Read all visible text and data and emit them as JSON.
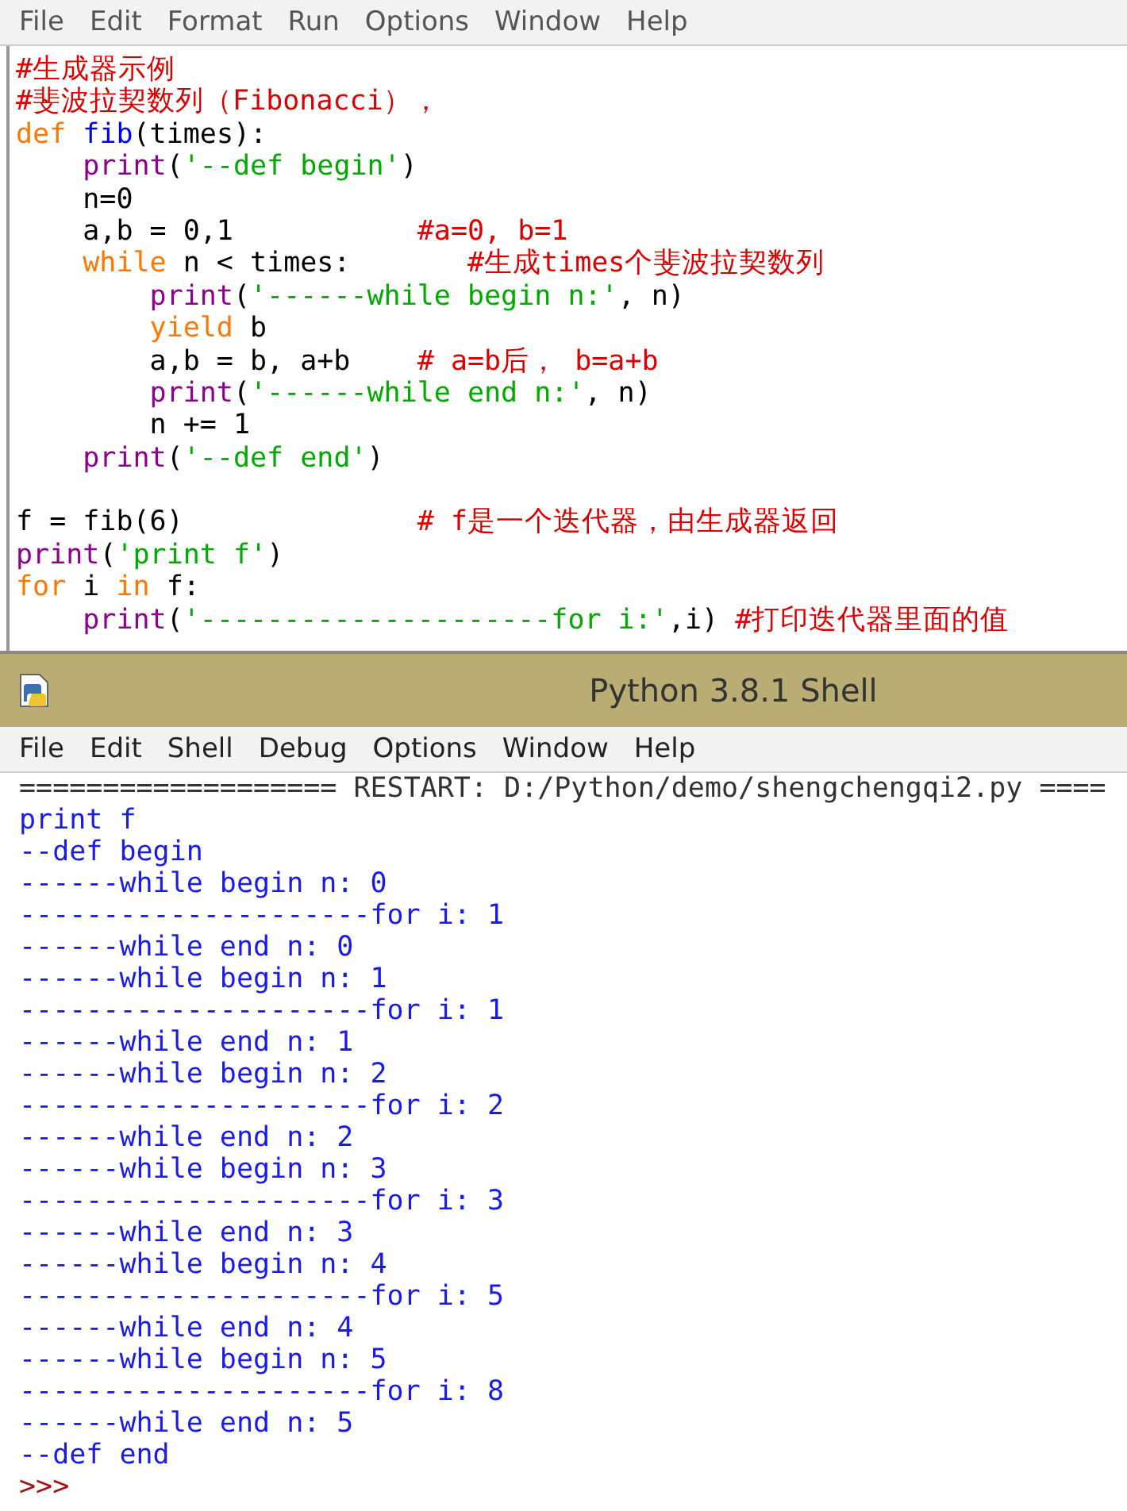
{
  "editor": {
    "menu": [
      "File",
      "Edit",
      "Format",
      "Run",
      "Options",
      "Window",
      "Help"
    ],
    "lines": [
      {
        "tokens": [
          {
            "kind": "comment",
            "text": "#生成器示例"
          }
        ]
      },
      {
        "tokens": [
          {
            "kind": "comment",
            "text": "#斐波拉契数列（Fibonacci），"
          }
        ]
      },
      {
        "tokens": [
          {
            "kind": "keyword",
            "text": "def "
          },
          {
            "kind": "definition",
            "text": "fib"
          },
          {
            "kind": "plain",
            "text": "(times):"
          }
        ]
      },
      {
        "tokens": [
          {
            "kind": "builtin",
            "text": "    print"
          },
          {
            "kind": "plain",
            "text": "("
          },
          {
            "kind": "string",
            "text": "'--def begin'"
          },
          {
            "kind": "plain",
            "text": ")"
          }
        ]
      },
      {
        "tokens": [
          {
            "kind": "plain",
            "text": "    n=0"
          }
        ]
      },
      {
        "tokens": [
          {
            "kind": "plain",
            "text": "    a,b = 0,1           "
          },
          {
            "kind": "comment",
            "text": "#a=0, b=1"
          }
        ]
      },
      {
        "tokens": [
          {
            "kind": "keyword",
            "text": "    while"
          },
          {
            "kind": "plain",
            "text": " n < times:       "
          },
          {
            "kind": "comment",
            "text": "#生成times个斐波拉契数列"
          }
        ]
      },
      {
        "tokens": [
          {
            "kind": "builtin",
            "text": "        print"
          },
          {
            "kind": "plain",
            "text": "("
          },
          {
            "kind": "string",
            "text": "'------while begin n:'"
          },
          {
            "kind": "plain",
            "text": ", n)"
          }
        ]
      },
      {
        "tokens": [
          {
            "kind": "keyword",
            "text": "        yield"
          },
          {
            "kind": "plain",
            "text": " b"
          }
        ]
      },
      {
        "tokens": [
          {
            "kind": "plain",
            "text": "        a,b = b, a+b    "
          },
          {
            "kind": "comment",
            "text": "# a=b后， b=a+b"
          }
        ]
      },
      {
        "tokens": [
          {
            "kind": "builtin",
            "text": "        print"
          },
          {
            "kind": "plain",
            "text": "("
          },
          {
            "kind": "string",
            "text": "'------while end n:'"
          },
          {
            "kind": "plain",
            "text": ", n)"
          }
        ]
      },
      {
        "tokens": [
          {
            "kind": "plain",
            "text": "        n += 1"
          }
        ]
      },
      {
        "tokens": [
          {
            "kind": "builtin",
            "text": "    print"
          },
          {
            "kind": "plain",
            "text": "("
          },
          {
            "kind": "string",
            "text": "'--def end'"
          },
          {
            "kind": "plain",
            "text": ")"
          }
        ]
      },
      {
        "gap_before": true,
        "tokens": [
          {
            "kind": "plain",
            "text": "f = fib(6)              "
          },
          {
            "kind": "comment",
            "text": "# f是一个迭代器，由生成器返回"
          }
        ]
      },
      {
        "tokens": [
          {
            "kind": "builtin",
            "text": "print"
          },
          {
            "kind": "plain",
            "text": "("
          },
          {
            "kind": "string",
            "text": "'print f'"
          },
          {
            "kind": "plain",
            "text": ")"
          }
        ]
      },
      {
        "tokens": [
          {
            "kind": "keyword",
            "text": "for"
          },
          {
            "kind": "plain",
            "text": " i "
          },
          {
            "kind": "keyword",
            "text": "in"
          },
          {
            "kind": "plain",
            "text": " f:"
          }
        ]
      },
      {
        "tokens": [
          {
            "kind": "builtin",
            "text": "    print"
          },
          {
            "kind": "plain",
            "text": "("
          },
          {
            "kind": "string",
            "text": "'---------------------for i:'"
          },
          {
            "kind": "plain",
            "text": ",i) "
          },
          {
            "kind": "comment",
            "text": "#打印迭代器里面的值"
          }
        ]
      }
    ]
  },
  "shell": {
    "title": "Python 3.8.1 Shell",
    "menu": [
      "File",
      "Edit",
      "Shell",
      "Debug",
      "Options",
      "Window",
      "Help"
    ],
    "lines": [
      {
        "kind": "restart",
        "text": "=================== RESTART: D:/Python/demo/shengchengqi2.py ===="
      },
      {
        "kind": "stdout",
        "text": "print f"
      },
      {
        "kind": "stdout",
        "text": "--def begin"
      },
      {
        "kind": "stdout",
        "text": "------while begin n: 0"
      },
      {
        "kind": "stdout",
        "text": "---------------------for i: 1"
      },
      {
        "kind": "stdout",
        "text": "------while end n: 0"
      },
      {
        "kind": "stdout",
        "text": "------while begin n: 1"
      },
      {
        "kind": "stdout",
        "text": "---------------------for i: 1"
      },
      {
        "kind": "stdout",
        "text": "------while end n: 1"
      },
      {
        "kind": "stdout",
        "text": "------while begin n: 2"
      },
      {
        "kind": "stdout",
        "text": "---------------------for i: 2"
      },
      {
        "kind": "stdout",
        "text": "------while end n: 2"
      },
      {
        "kind": "stdout",
        "text": "------while begin n: 3"
      },
      {
        "kind": "stdout",
        "text": "---------------------for i: 3"
      },
      {
        "kind": "stdout",
        "text": "------while end n: 3"
      },
      {
        "kind": "stdout",
        "text": "------while begin n: 4"
      },
      {
        "kind": "stdout",
        "text": "---------------------for i: 5"
      },
      {
        "kind": "stdout",
        "text": "------while end n: 4"
      },
      {
        "kind": "stdout",
        "text": "------while begin n: 5"
      },
      {
        "kind": "stdout",
        "text": "---------------------for i: 8"
      },
      {
        "kind": "stdout",
        "text": "------while end n: 5"
      },
      {
        "kind": "stdout",
        "text": "--def end"
      },
      {
        "kind": "prompt",
        "text": ">>>"
      }
    ]
  }
}
